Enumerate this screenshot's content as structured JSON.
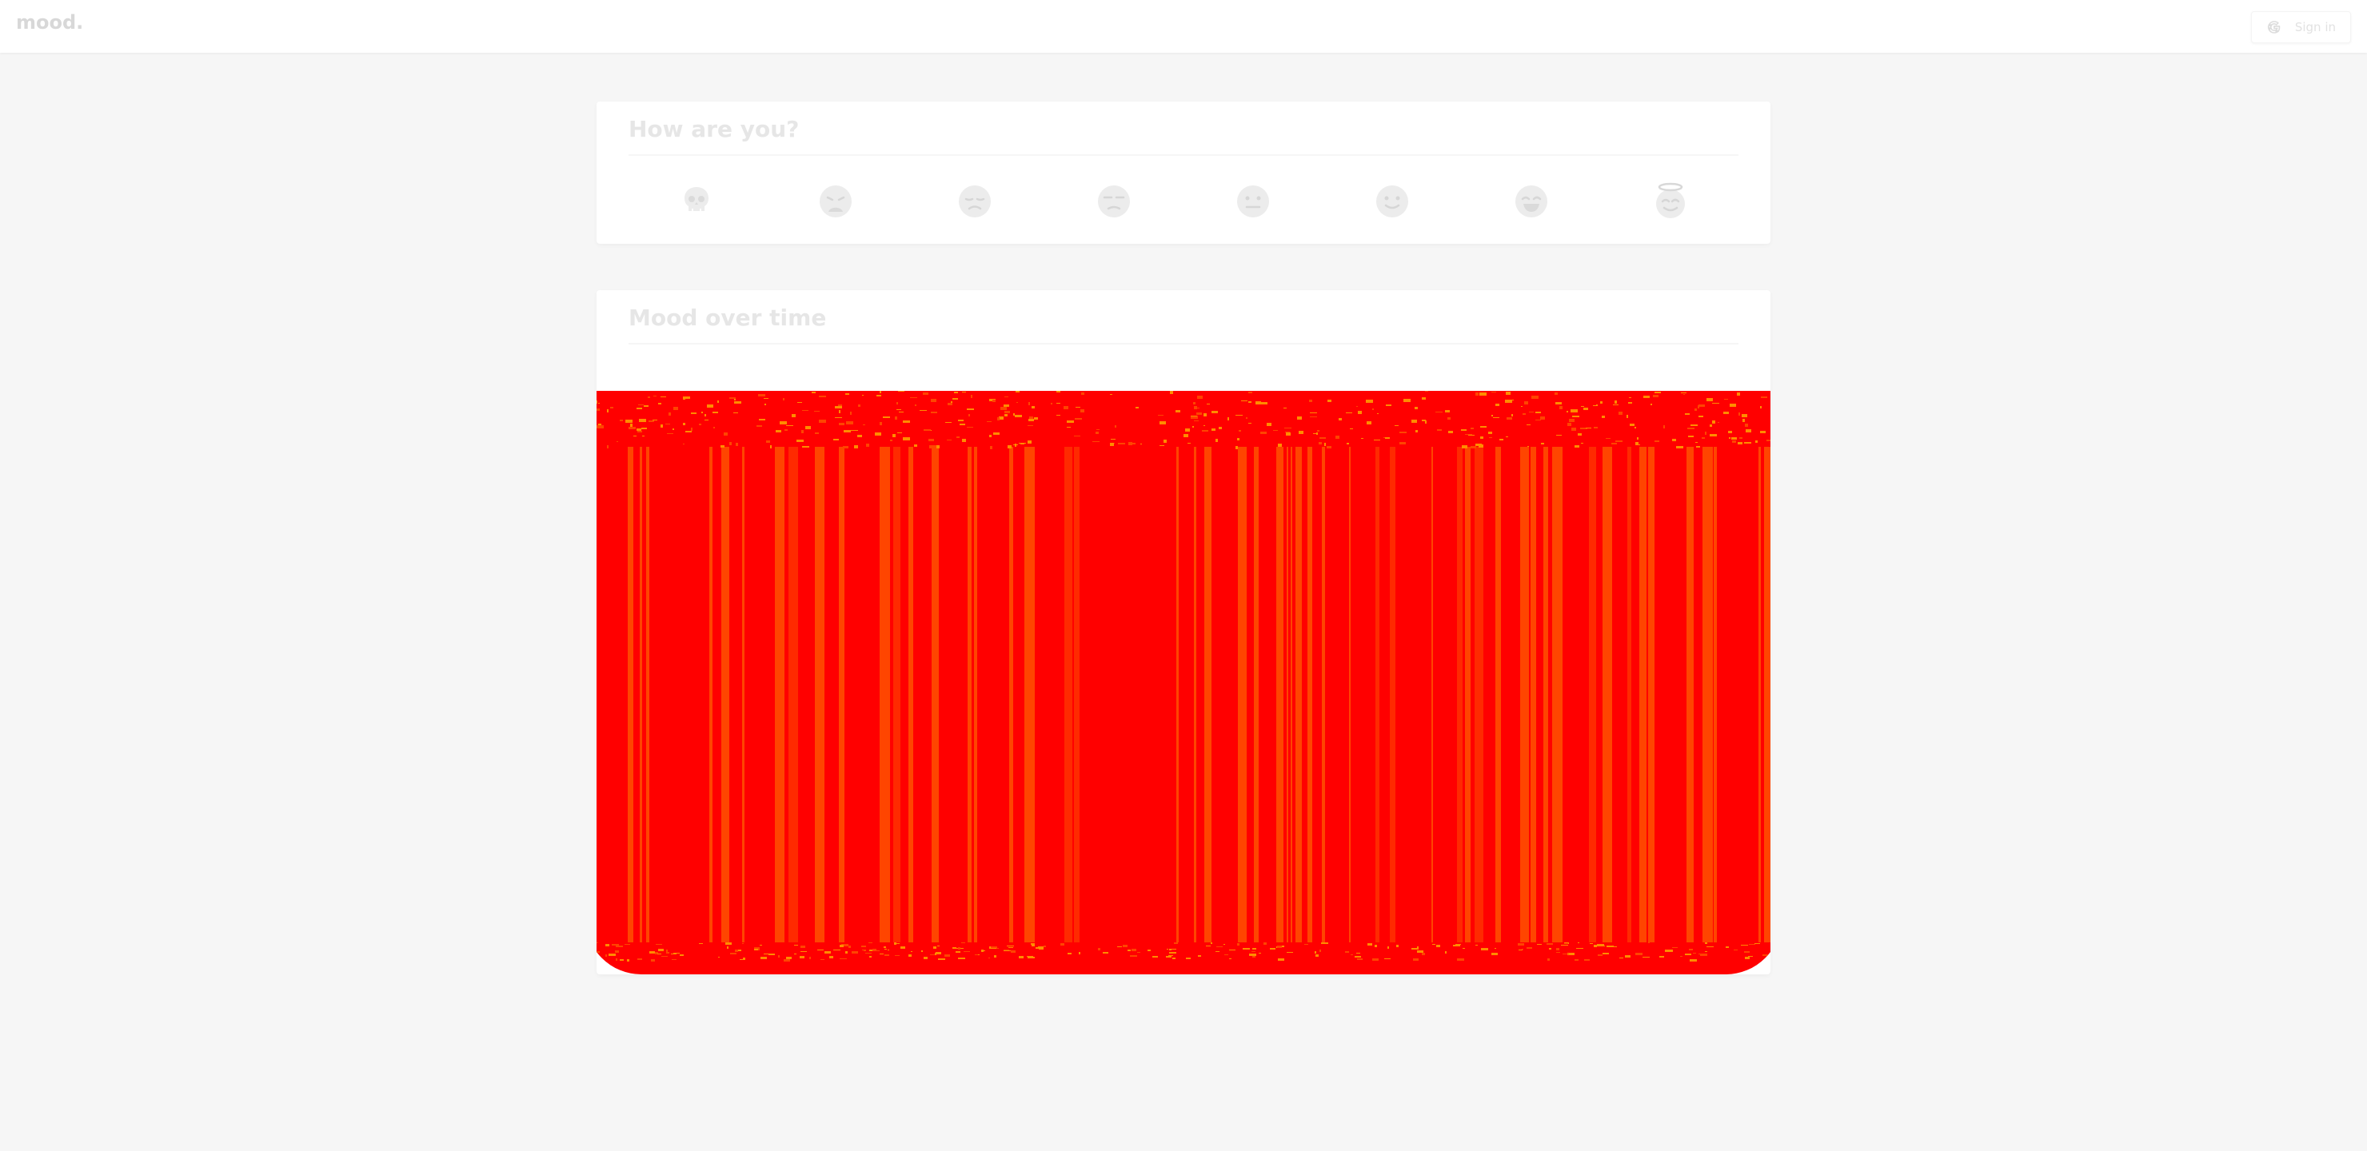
{
  "app": {
    "logo": "mood.",
    "signin": {
      "label": "Sign in",
      "icon": "google-icon"
    }
  },
  "mood_card": {
    "title": "How are you?",
    "moods": [
      {
        "icon": "skull-icon"
      },
      {
        "icon": "weary-face-icon"
      },
      {
        "icon": "sad-face-icon"
      },
      {
        "icon": "unamused-face-icon"
      },
      {
        "icon": "neutral-face-icon"
      },
      {
        "icon": "slightly-smiling-face-icon"
      },
      {
        "icon": "grinning-face-icon"
      },
      {
        "icon": "smiling-face-with-halo-icon"
      }
    ]
  },
  "chart_card": {
    "title": "Mood over time"
  },
  "colors": {
    "background": "#f6f6f6",
    "card": "#ffffff",
    "chart_red": "#ff0000",
    "chart_orange": "#ff4500",
    "chart_amber": "#ff8c00"
  },
  "chart_data": {
    "type": "area",
    "title": "",
    "xlabel": "",
    "ylabel": "",
    "grid": false,
    "legend": "none",
    "series": [
      {
        "values": []
      }
    ]
  }
}
